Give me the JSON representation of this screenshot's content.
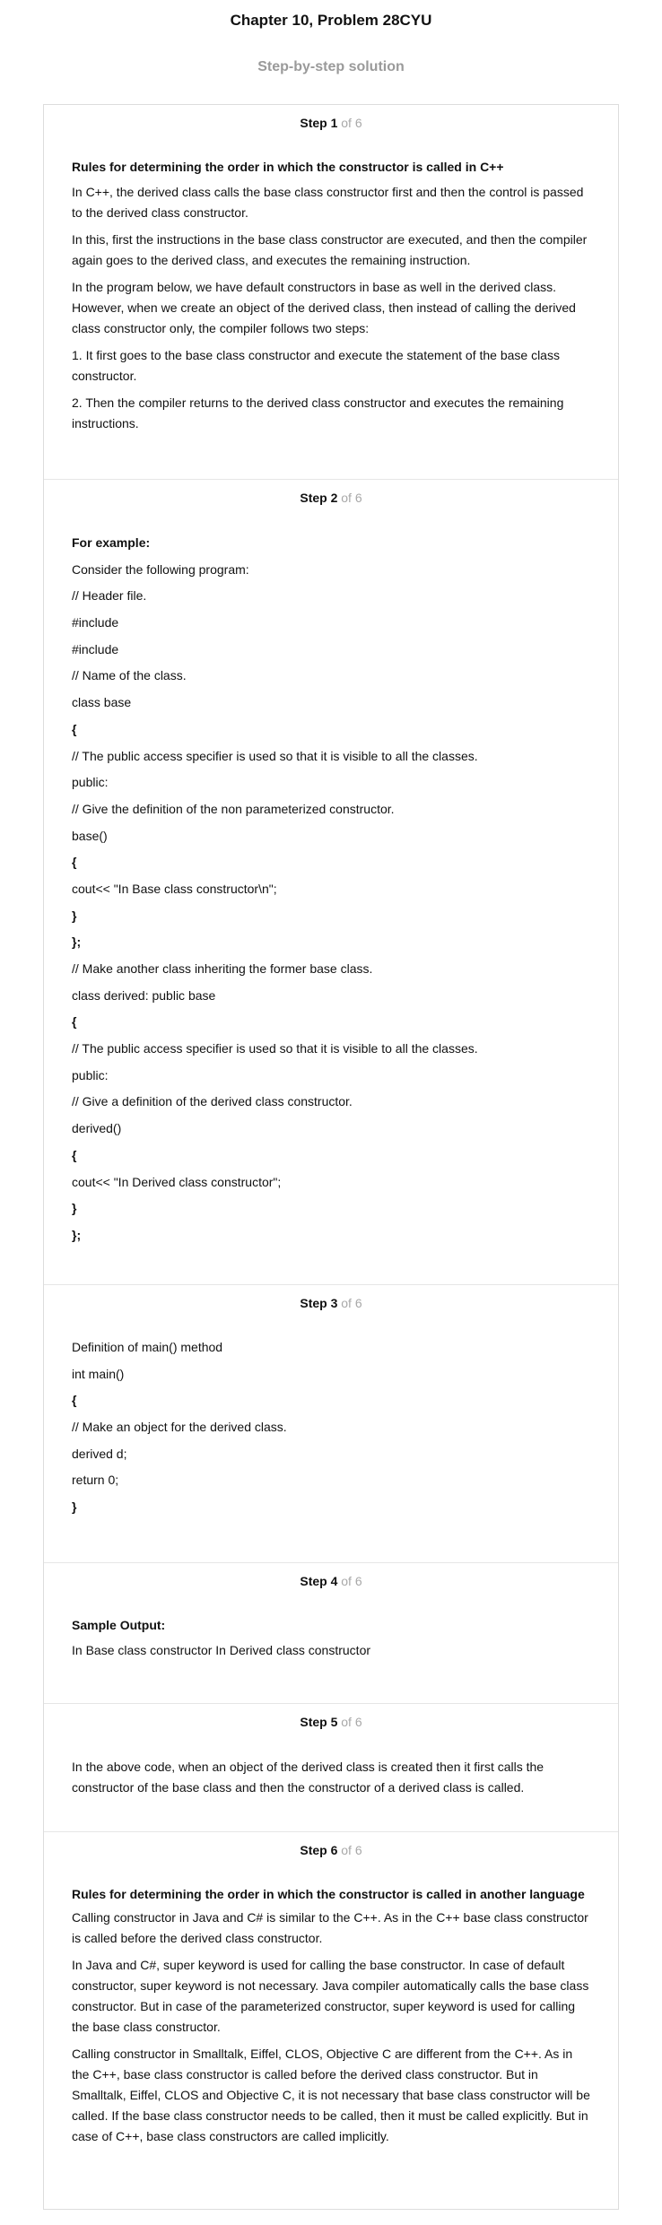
{
  "title": "Chapter 10, Problem 28CYU",
  "subtitle": "Step-by-step solution",
  "steps": [
    {
      "label": "Step 1",
      "of": "of 6",
      "heading": "Rules for determining the order in which the constructor is called in C++",
      "paragraphs": [
        "In C++, the derived class calls the base class constructor first and then the control is passed to the derived class constructor.",
        "In this, first the instructions in the base class constructor are executed, and then the compiler again goes to the derived class, and executes the remaining instruction.",
        "In the program below, we have default constructors in base as well in the derived class. However, when we create an object of the derived class, then instead of calling the derived class constructor only, the compiler follows two steps:",
        "1. It first goes to the base class constructor and execute the statement of the base class constructor.",
        "2. Then the compiler returns to the derived class constructor and executes the remaining instructions."
      ]
    },
    {
      "label": "Step 2",
      "of": "of 6",
      "heading": "For example:",
      "lines": [
        "Consider the following program:",
        "// Header file.",
        "#include",
        "#include",
        "// Name of the class.",
        "class base",
        "{",
        "// The public access specifier is used so that it is visible to all the classes.",
        "public:",
        "// Give the definition of the non parameterized constructor.",
        "base()",
        "{",
        "cout<< \"In Base class constructor\\n\";",
        "}",
        "};",
        "// Make another class inheriting the former base class.",
        "class derived: public base",
        "{",
        "// The public access specifier is used so that it is visible to all the classes.",
        "public:",
        "// Give a definition of the derived class constructor.",
        "derived()",
        "{",
        "cout<< \"In Derived class constructor\";",
        "}",
        "};"
      ]
    },
    {
      "label": "Step 3",
      "of": "of 6",
      "lines": [
        "Definition of main() method",
        "int main()",
        "{",
        "// Make an object for the derived class.",
        "derived d;",
        "return 0;",
        "}"
      ]
    },
    {
      "label": "Step 4",
      "of": "of 6",
      "heading": "Sample Output:",
      "paragraphs": [
        "In Base class constructor In Derived class constructor"
      ]
    },
    {
      "label": "Step 5",
      "of": "of 6",
      "paragraphs": [
        "In the above code, when an object of the derived class is created then it first calls the constructor of the base class and then the constructor of a derived class is called."
      ]
    },
    {
      "label": "Step 6",
      "of": "of 6",
      "heading": "Rules for determining the order in which the constructor is called in another language",
      "paragraphs": [
        "Calling constructor in Java and C# is similar to the C++. As in the C++ base class constructor is called before the derived class constructor.",
        "In Java and C#, super keyword is used for calling the base constructor. In case of default constructor, super keyword is not necessary. Java compiler automatically calls the base class constructor. But in case of the parameterized constructor, super keyword is used for calling the base class constructor.",
        "Calling constructor in Smalltalk, Eiffel, CLOS, Objective C are different from the C++. As in the C++, base class constructor is called before the derived class constructor. But in Smalltalk, Eiffel, CLOS and Objective C, it is not necessary that base class constructor will be called. If the base class constructor needs to be called, then it must be called explicitly. But in case of C++, base class constructors are called implicitly."
      ]
    }
  ]
}
